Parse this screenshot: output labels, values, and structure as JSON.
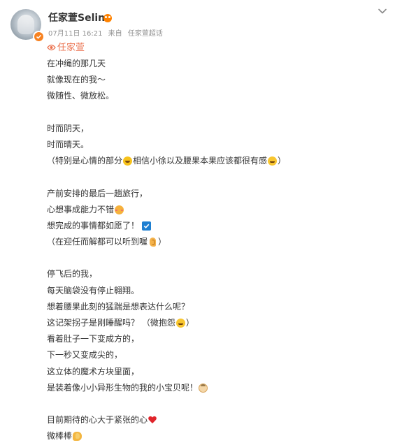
{
  "post": {
    "author": "任家萱Selina",
    "date": "07月11日 16:21",
    "source_prefix": "来自",
    "source": "任家萱超话",
    "topic": "任家萱",
    "lines": [
      {
        "text": "在冲绳的那几天"
      },
      {
        "text": "就像现在的我～"
      },
      {
        "text": "微随性、微放松。"
      },
      {
        "text": ""
      },
      {
        "text": "时而阴天，"
      },
      {
        "text": "时而晴天。"
      },
      {
        "text": "（特别是心情的部分",
        "emoji": "laugh-emoji",
        "text2": "相信小徐以及腰果本果应该都很有感",
        "emoji2": "grin-emoji",
        "text3": "）"
      },
      {
        "text": ""
      },
      {
        "text": "产前安排的最后一趟旅行，"
      },
      {
        "text": "心想事成能力不错",
        "emoji": "blush-emoji"
      },
      {
        "text": "想完成的事情都如愿了！",
        "emoji": "check-emoji"
      },
      {
        "text": "（在迎任而解都可以听到喔",
        "emoji": "ear-emoji",
        "text2": "）"
      },
      {
        "text": ""
      },
      {
        "text": "停飞后的我，"
      },
      {
        "text": "每天脑袋没有停止翱翔。"
      },
      {
        "text": "想着腰果此刻的猛踹是想表达什么呢？"
      },
      {
        "text": "这记架拐子是刚睡醒吗？ （微抱怨",
        "emoji": "grin-emoji",
        "text2": "）"
      },
      {
        "text": "看着肚子一下变成方的，"
      },
      {
        "text": "下一秒又变成尖的，"
      },
      {
        "text": "这立体的魔术方块里面，"
      },
      {
        "text": "是装着像小小异形生物的我的小宝贝呢！",
        "emoji": "baby-emoji"
      },
      {
        "text": ""
      },
      {
        "text": "目前期待的心大于紧张的心",
        "emoji": "heart-emoji"
      },
      {
        "text": "微棒棒",
        "emoji": "clap-emoji"
      }
    ]
  },
  "icons": {
    "avatar": "avatar",
    "verified": "verified-badge-icon",
    "member": "member-icon",
    "menu": "chevron-down-icon",
    "topic": "supertopic-icon"
  },
  "colors": {
    "text": "#333333",
    "meta": "#939393",
    "topic": "#eb7350",
    "verified": "#f78221"
  }
}
